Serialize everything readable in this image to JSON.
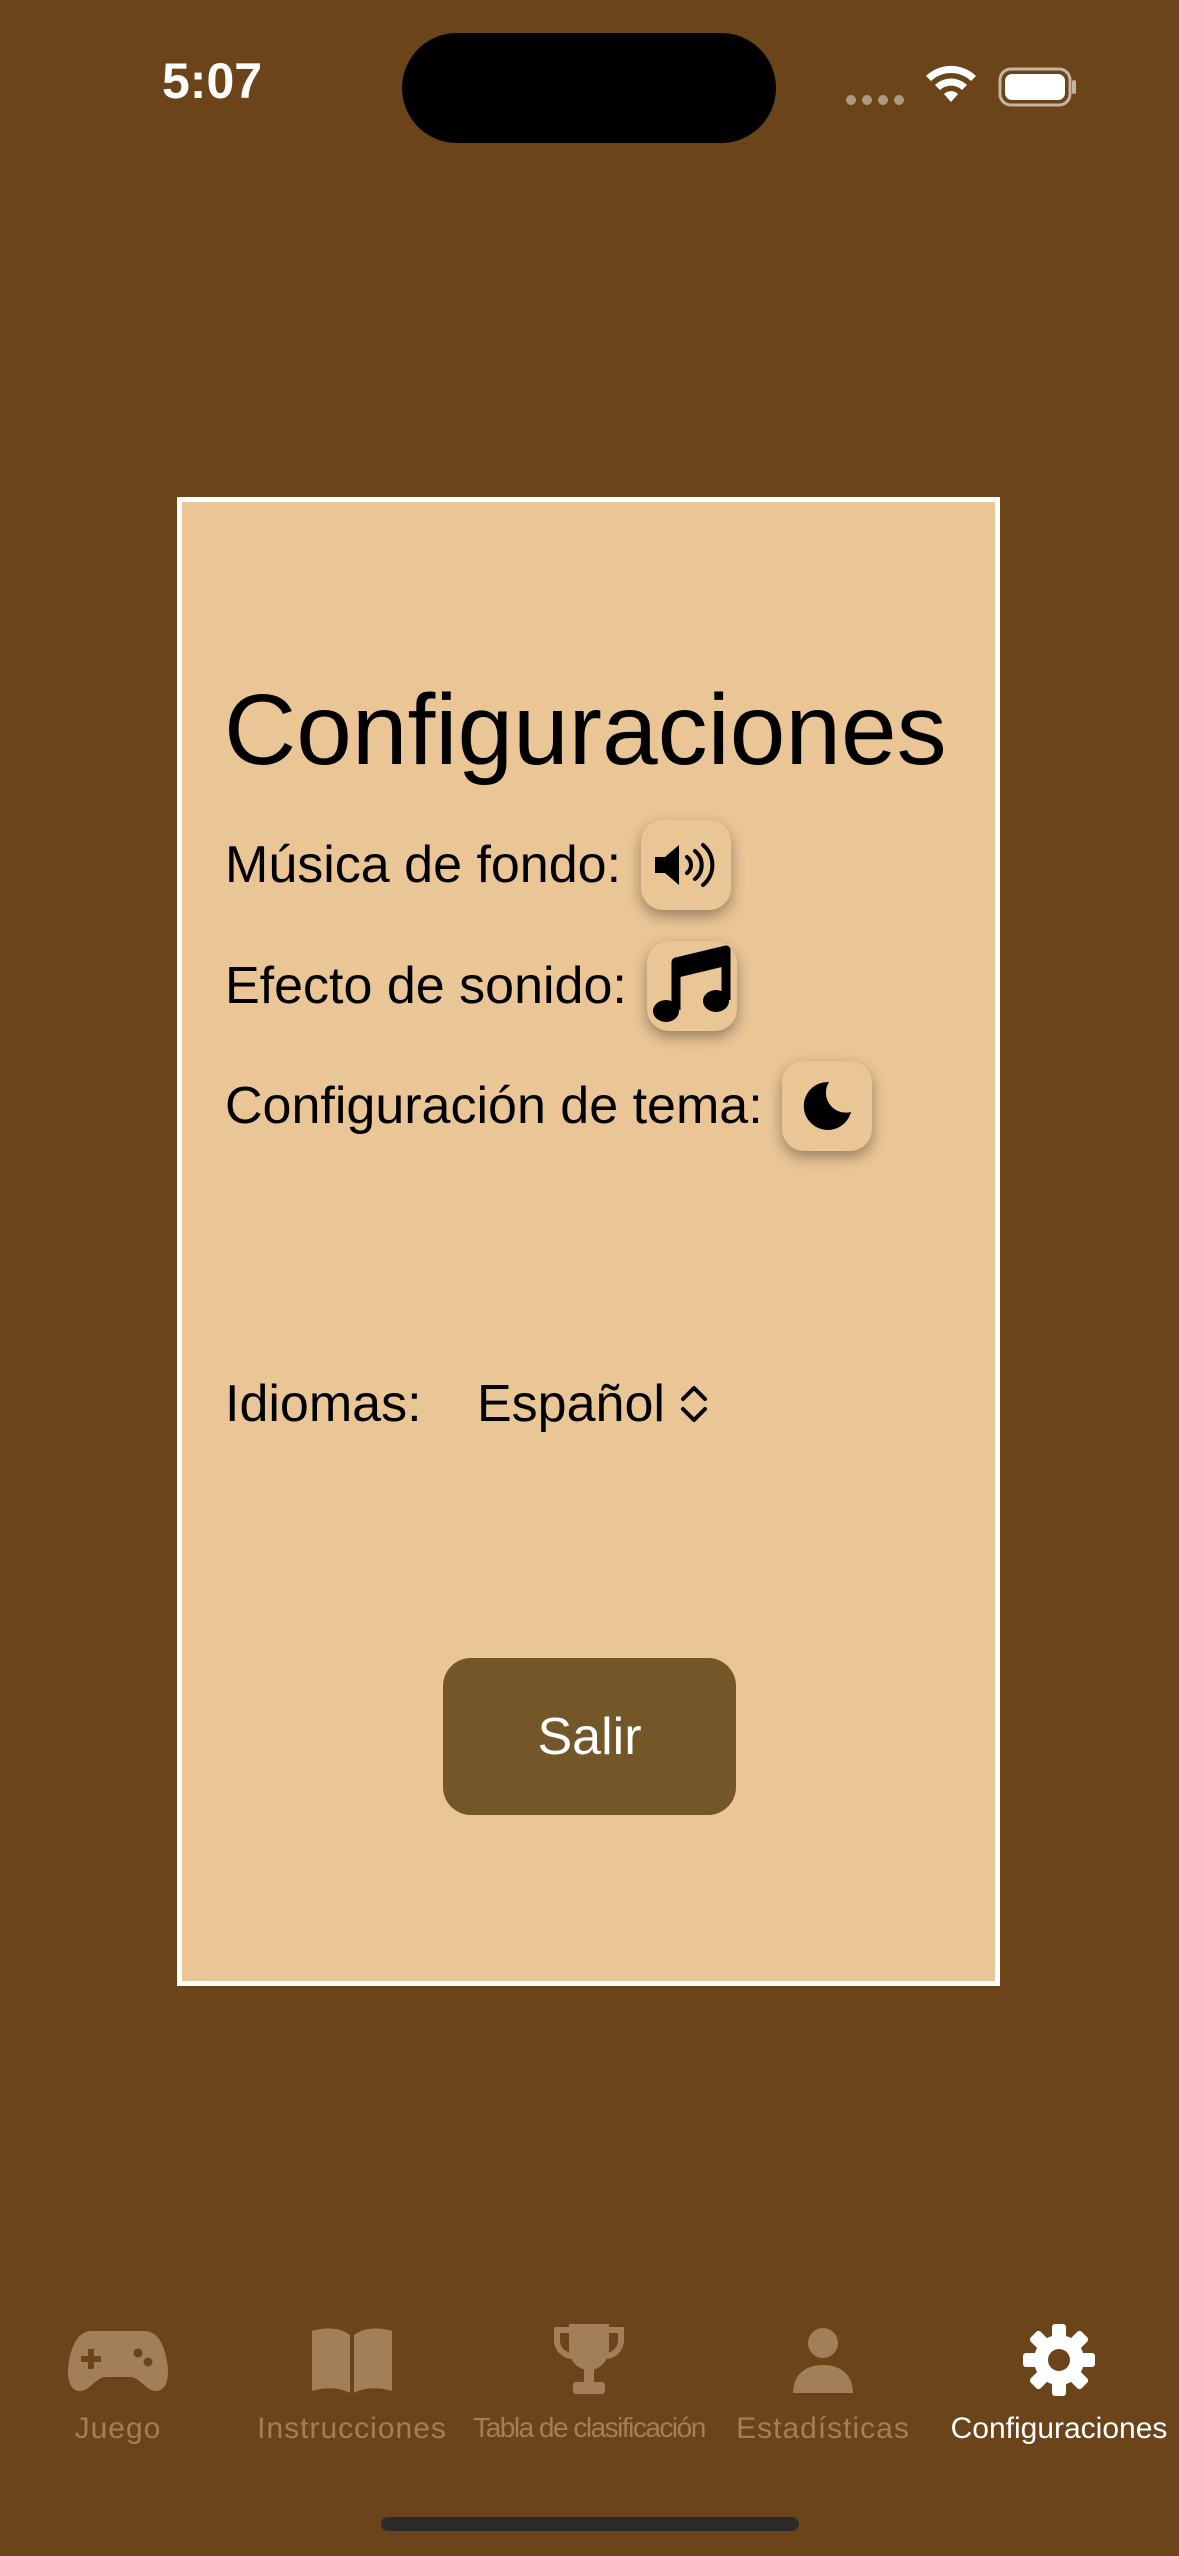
{
  "status_bar": {
    "time": "5:07"
  },
  "settings": {
    "title": "Configuraciones",
    "rows": [
      {
        "label": "Música de fondo:",
        "icon": "speaker-wave-icon"
      },
      {
        "label": "Efecto de sonido:",
        "icon": "music-note-icon"
      },
      {
        "label": "Configuración de tema:",
        "icon": "moon-icon"
      }
    ],
    "language": {
      "label": "Idiomas:",
      "selected": "Español"
    },
    "exit_label": "Salir"
  },
  "tab_bar": {
    "tabs": [
      {
        "label": "Juego",
        "icon": "gamepad-icon",
        "active": false
      },
      {
        "label": "Instrucciones",
        "icon": "book-icon",
        "active": false
      },
      {
        "label": "Tabla de clasificación",
        "icon": "trophy-icon",
        "active": false
      },
      {
        "label": "Estadísticas",
        "icon": "person-icon",
        "active": false
      },
      {
        "label": "Configuraciones",
        "icon": "gear-icon",
        "active": true
      }
    ],
    "active_color": "#ffffff",
    "inactive_color": "#a27f58"
  },
  "colors": {
    "background": "#6b4419",
    "card": "#eac596",
    "button": "#735728"
  }
}
